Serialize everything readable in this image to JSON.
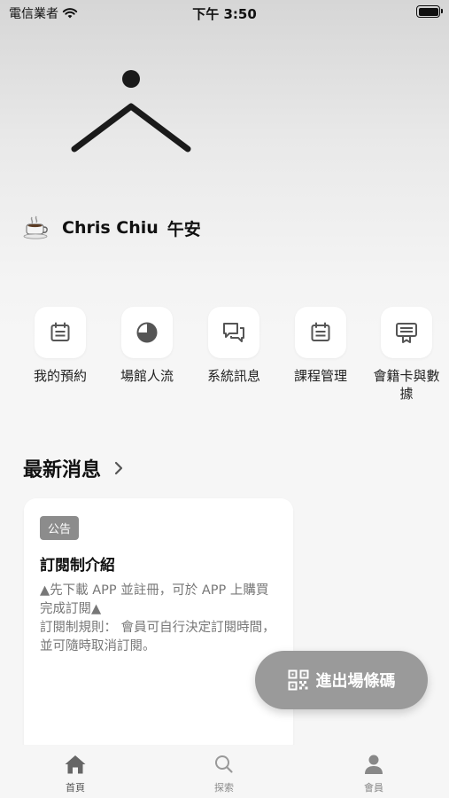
{
  "status_bar": {
    "carrier": "電信業者",
    "time": "下午 3:50",
    "battery_level": 1.0
  },
  "greeting": {
    "icon": "coffee-icon",
    "name": "Chris Chiu",
    "word": "午安"
  },
  "quick_actions": [
    {
      "label": "我的預約",
      "icon": "calendar-icon"
    },
    {
      "label": "場館人流",
      "icon": "pie-chart-icon"
    },
    {
      "label": "系統訊息",
      "icon": "chat-bubbles-icon"
    },
    {
      "label": "課程管理",
      "icon": "calendar-icon"
    },
    {
      "label": "會籍卡與數據",
      "icon": "membership-card-icon"
    }
  ],
  "news": {
    "section_title": "最新消息",
    "card": {
      "tag": "公告",
      "title": "訂閱制介紹",
      "body": "▲先下載  APP 並註冊，可於 APP 上購買完成訂閱▲\n 訂閱制規則： 會員可自行決定訂閱時間，並可隨時取消訂閱。"
    }
  },
  "fab": {
    "label": "進出場條碼",
    "icon": "qr-code-icon"
  },
  "tab_bar": [
    {
      "label": "首頁",
      "icon": "home-icon",
      "active": true
    },
    {
      "label": "探索",
      "icon": "search-icon",
      "active": false
    },
    {
      "label": "會員",
      "icon": "person-icon",
      "active": false
    }
  ],
  "colors": {
    "fab_background": "#9a9a9a",
    "tag_background": "#8c8c8c",
    "text_primary": "#111111",
    "text_secondary": "#777777"
  }
}
